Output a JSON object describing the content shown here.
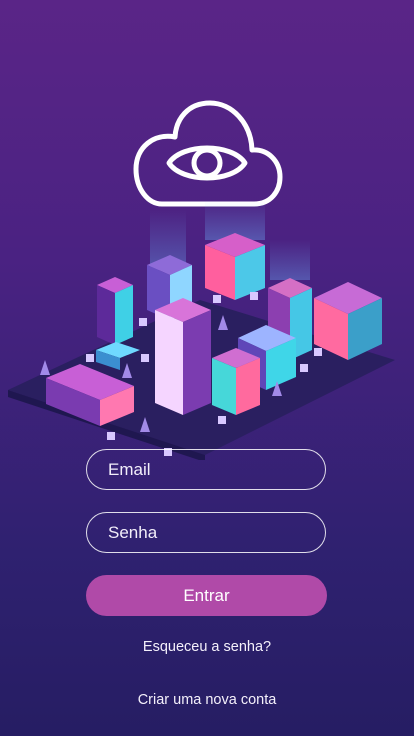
{
  "logo": {
    "icon": "cloud-eye-icon"
  },
  "illustration": {
    "icon": "isometric-city-illustration"
  },
  "login": {
    "email_placeholder": "Email",
    "password_placeholder": "Senha",
    "submit_label": "Entrar",
    "forgot_password_label": "Esqueceu a senha?",
    "create_account_label": "Criar uma nova conta"
  },
  "colors": {
    "button": "#b04aa8",
    "background_top": "#5a2587",
    "background_bottom": "#261d63"
  }
}
